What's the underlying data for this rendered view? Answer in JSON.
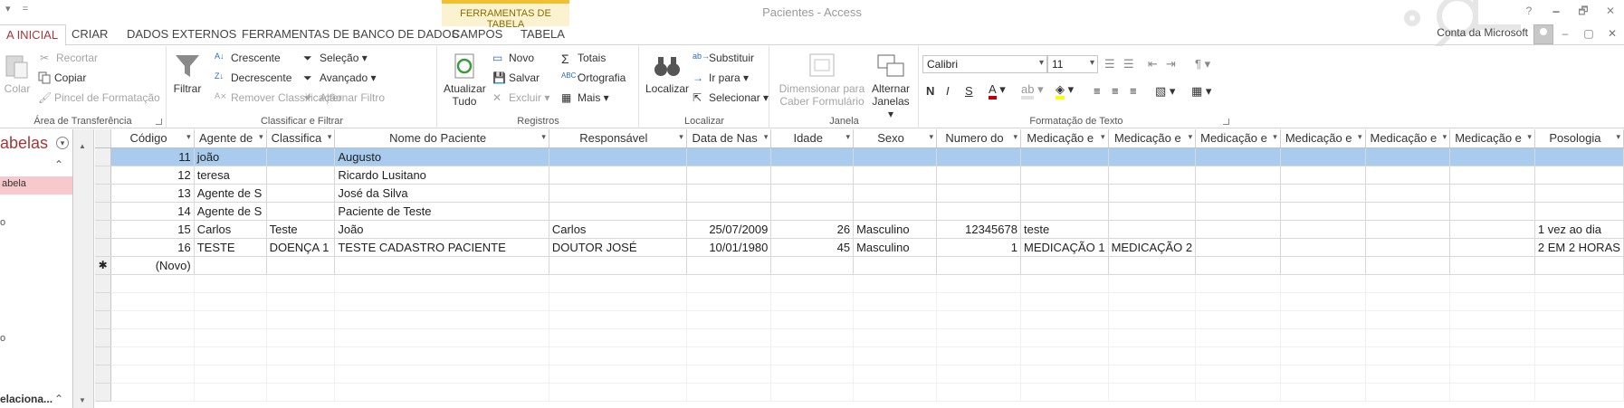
{
  "window": {
    "title": "Pacientes - Access",
    "qat": [
      "▾",
      "="
    ],
    "controls": [
      "?",
      "🗕",
      "🗗",
      "✕"
    ]
  },
  "context_header": "FERRAMENTAS DE TABELA",
  "tabs": [
    {
      "label": "A INICIAL",
      "active": true
    },
    {
      "label": "CRIAR"
    },
    {
      "label": "DADOS EXTERNOS"
    },
    {
      "label": "FERRAMENTAS DE BANCO DE DADOS"
    },
    {
      "label": "CAMPOS"
    },
    {
      "label": "TABELA"
    }
  ],
  "account": "Conta da Microsoft",
  "ribbon": {
    "clipboard": {
      "label": "Área de Transferência",
      "paste": "Colar",
      "cut": "Recortar",
      "copy": "Copiar",
      "format_painter": "Pincel de Formatação"
    },
    "sort_filter": {
      "label": "Classificar e Filtrar",
      "filter": "Filtrar",
      "ascending": "Crescente",
      "descending": "Decrescente",
      "remove_sort": "Remover Classificação",
      "selection": "Seleção",
      "advanced": "Avançado",
      "toggle_filter": "Alternar Filtro"
    },
    "records": {
      "label": "Registros",
      "refresh": "Atualizar",
      "refresh2": "Tudo",
      "new": "Novo",
      "save": "Salvar",
      "delete": "Excluir",
      "totals": "Totais",
      "spelling": "Ortografia",
      "more": "Mais"
    },
    "find": {
      "label": "Localizar",
      "find": "Localizar",
      "replace": "Substituir",
      "goto": "Ir para",
      "select": "Selecionar"
    },
    "window": {
      "label": "Janela",
      "size_to_fit": "Dimensionar para",
      "size_to_fit2": "Caber Formulário",
      "switch": "Alternar",
      "switch2": "Janelas"
    },
    "text_format": {
      "label": "Formatação de Texto",
      "font": "Calibri",
      "size": "11",
      "bold": "N",
      "italic": "I",
      "underline": "S",
      "font_color": "#c00000",
      "highlight_color": "#ffff00"
    }
  },
  "nav": {
    "title": "abelas",
    "item": "abela",
    "group": "elaciona...",
    "misc1": "o",
    "misc2": "o"
  },
  "table": {
    "columns": [
      "Código",
      "Agente de",
      "Classifica",
      "Nome do Paciente",
      "Responsável",
      "Data de Nas",
      "Idade",
      "Sexo",
      "Numero do",
      "Medicação e",
      "Medicação e",
      "Medicação e",
      "Medicação e",
      "Medicação e",
      "Medicação e",
      "Posologia"
    ],
    "rows": [
      [
        "11",
        "joão",
        "",
        "Augusto",
        "",
        "",
        "",
        "",
        "",
        "",
        "",
        "",
        "",
        "",
        "",
        ""
      ],
      [
        "12",
        "teresa",
        "",
        "Ricardo Lusitano",
        "",
        "",
        "",
        "",
        "",
        "",
        "",
        "",
        "",
        "",
        "",
        ""
      ],
      [
        "13",
        "Agente de S",
        "",
        "José da Silva",
        "",
        "",
        "",
        "",
        "",
        "",
        "",
        "",
        "",
        "",
        "",
        ""
      ],
      [
        "14",
        "Agente de S",
        "",
        "Paciente de Teste",
        "",
        "",
        "",
        "",
        "",
        "",
        "",
        "",
        "",
        "",
        "",
        ""
      ],
      [
        "15",
        "Carlos",
        "Teste",
        "João",
        "Carlos",
        "25/07/2009",
        "26",
        "Masculino",
        "12345678",
        "teste",
        "",
        "",
        "",
        "",
        "",
        "1 vez ao dia"
      ],
      [
        "16",
        "TESTE",
        "DOENÇA 1",
        "TESTE CADASTRO PACIENTE",
        "DOUTOR JOSÉ",
        "10/01/1980",
        "45",
        "Masculino",
        "1",
        "MEDICAÇÃO 1",
        "MEDICAÇÃO 2",
        "",
        "",
        "",
        "",
        "2 EM 2 HORAS"
      ]
    ],
    "new_row_label": "(Novo)",
    "new_row_marker": "✱",
    "current_row": 0
  }
}
